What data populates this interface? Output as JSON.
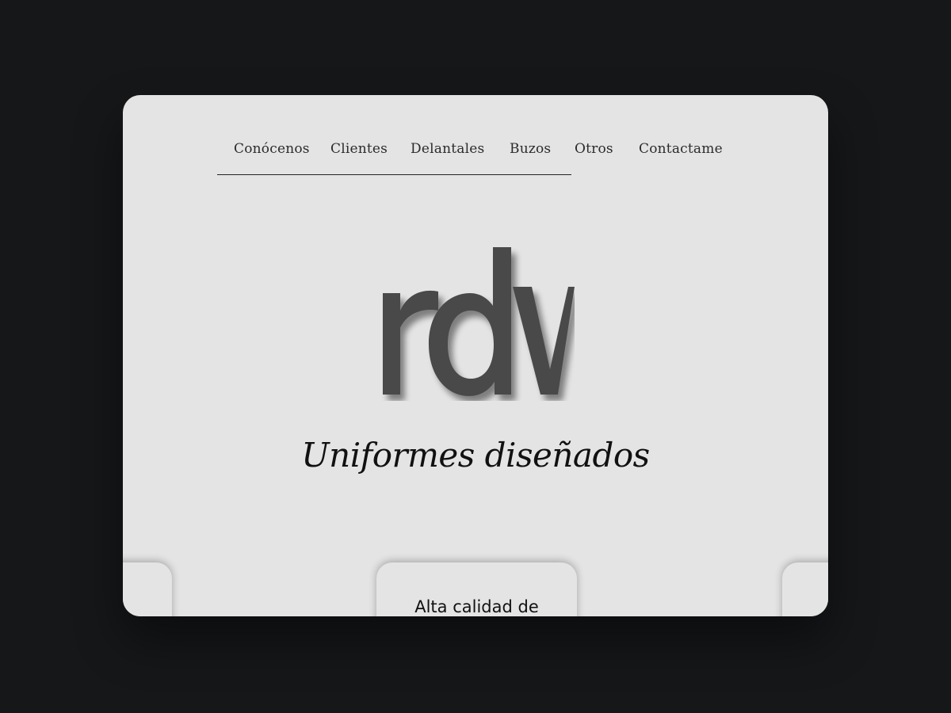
{
  "nav": {
    "items": [
      {
        "label": "Conócenos"
      },
      {
        "label": "Clientes"
      },
      {
        "label": "Delantales"
      },
      {
        "label": "Buzos"
      },
      {
        "label": "Otros"
      },
      {
        "label": "Contactame"
      }
    ]
  },
  "hero": {
    "logo_text": "rdv",
    "tagline": "Uniformes diseñados"
  },
  "cards": {
    "center_title": "Alta calidad de"
  },
  "colors": {
    "page_background": "#161719",
    "window_background": "#e4e4e4",
    "logo_fill": "#4a4a4a",
    "text": "#111111"
  }
}
